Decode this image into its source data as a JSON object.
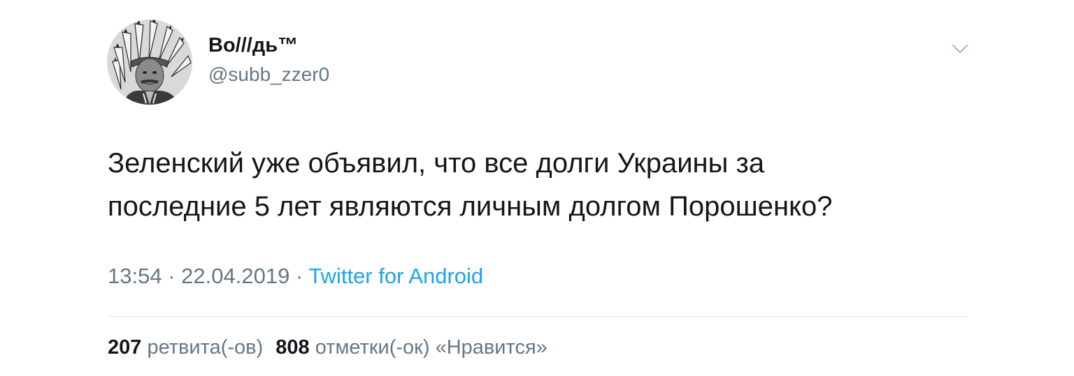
{
  "tweet": {
    "author": {
      "display_name": "Во///дь™",
      "handle": "@subb_zzer0",
      "avatar_icon": "profile-avatar-icon"
    },
    "menu_icon": "chevron-down-icon",
    "text_line_1": "Зеленский уже объявил, что все долги Украины за",
    "text_line_2": "последние 5 лет являются личным долгом Порошенко?",
    "time": "13:54",
    "separator": "·",
    "date": "22.04.2019",
    "source": "Twitter for Android",
    "retweets": {
      "count": "207",
      "label": "ретвита(-ов)"
    },
    "likes": {
      "count": "808",
      "label": "отметки(-ок) «Нравится»"
    }
  },
  "colors": {
    "text": "#14171a",
    "secondary": "#657786",
    "link": "#1da1f2",
    "divider": "#e1e8ed"
  }
}
